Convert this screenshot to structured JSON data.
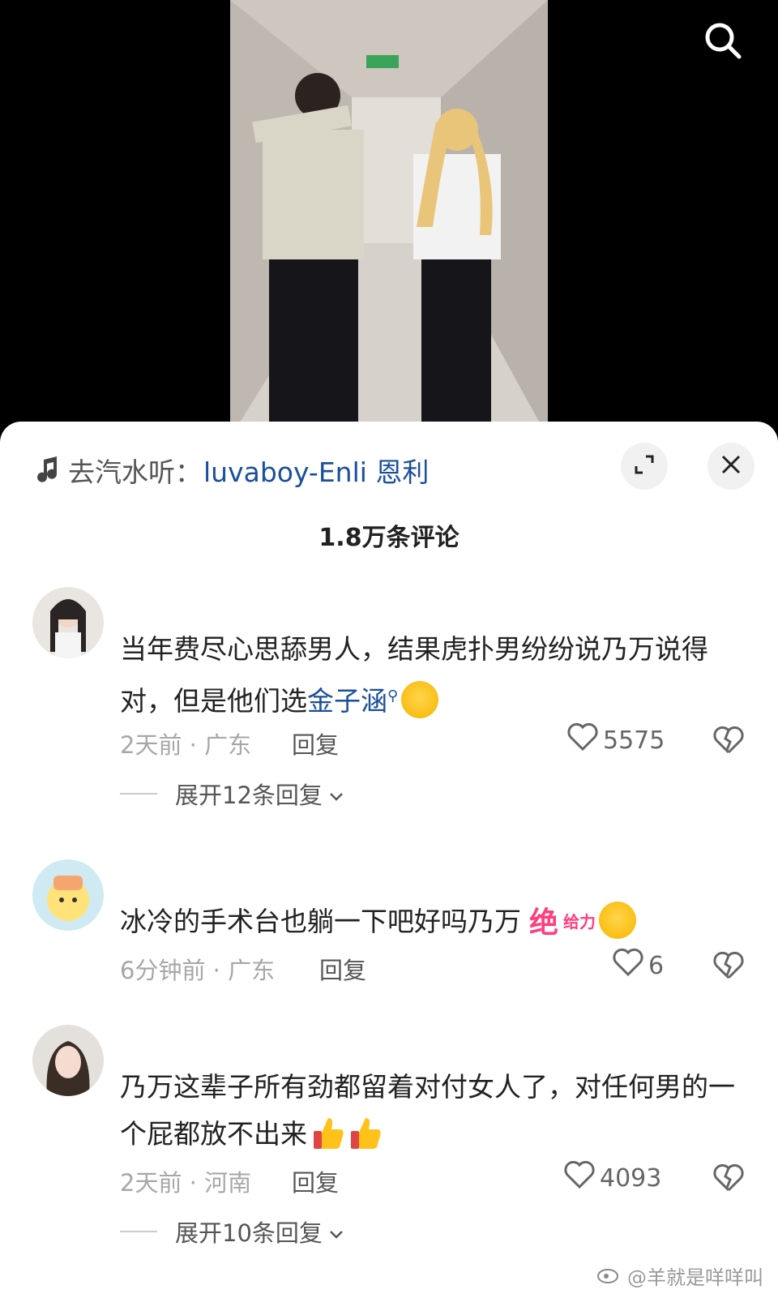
{
  "music": {
    "prefix": "去汽水听：",
    "song": "luvaboy-Enli 恩利"
  },
  "comments_count": "1.8万条评论",
  "comments": [
    {
      "text_plain": "当年费尽心思舔男人，结果虎扑男纷纷说乃万说得对，但是他们选",
      "link": "金子涵",
      "time": "2天前",
      "location": "广东",
      "reply_label": "回复",
      "likes": "5575",
      "expand": "展开12条回复"
    },
    {
      "text_plain": "冰冷的手术台也躺一下吧好吗乃万",
      "sticker_1": "绝",
      "sticker_2": "给力",
      "time": "6分钟前",
      "location": "广东",
      "reply_label": "回复",
      "likes": "6"
    },
    {
      "text_plain": "乃万这辈子所有劲都留着对付女人了，对任何男的一个屁都放不出来",
      "time": "2天前",
      "location": "河南",
      "reply_label": "回复",
      "likes": "4093",
      "expand": "展开10条回复"
    }
  ],
  "watermark": "@羊就是咩咩叫",
  "colors": {
    "link": "#1b4f9c",
    "sticker": "#ff3d7f",
    "meta": "#a7a7a7"
  },
  "icons": {
    "search": "search-icon",
    "expand": "expand-icon",
    "close": "close-icon",
    "like": "heart-outline-icon",
    "dislike": "broken-heart-icon",
    "music": "music-note-icon"
  }
}
